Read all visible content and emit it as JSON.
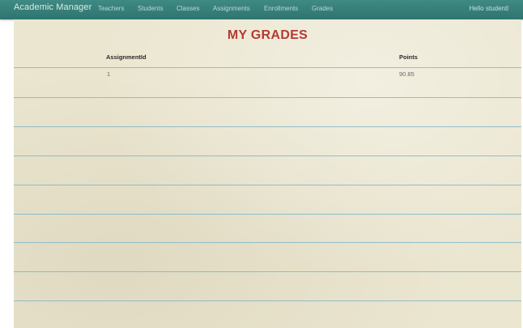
{
  "navbar": {
    "brand": "Academic Manager",
    "links": [
      "Teachers",
      "Students",
      "Classes",
      "Assignments",
      "Enrollments",
      "Grades"
    ],
    "greeting": "Hello studentl"
  },
  "page": {
    "title": "MY GRADES"
  },
  "grades_table": {
    "columns": [
      "AssignmentId",
      "Points"
    ],
    "rows": [
      [
        "1",
        "90.85"
      ]
    ]
  }
}
